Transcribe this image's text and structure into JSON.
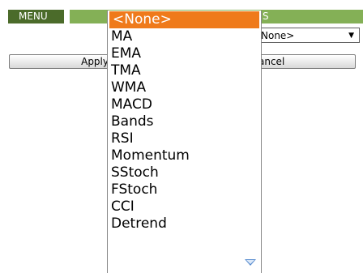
{
  "header": {
    "menu_label": "MENU",
    "title_fragment": "S"
  },
  "select": {
    "value": "None>"
  },
  "buttons": {
    "apply_label": "Apply",
    "cancel_label": "ancel"
  },
  "dropdown": {
    "options": [
      "<None>",
      "MA",
      "EMA",
      "TMA",
      "WMA",
      "MACD",
      "Bands",
      "RSI",
      "Momentum",
      "SStoch",
      "FStoch",
      "CCI",
      "Detrend"
    ],
    "selected_index": 0
  },
  "colors": {
    "menu_bg": "#4b6b2a",
    "title_bg": "#84b056",
    "selected_bg": "#ef7a1a",
    "scroll_arrow": "#5b8ed0"
  }
}
